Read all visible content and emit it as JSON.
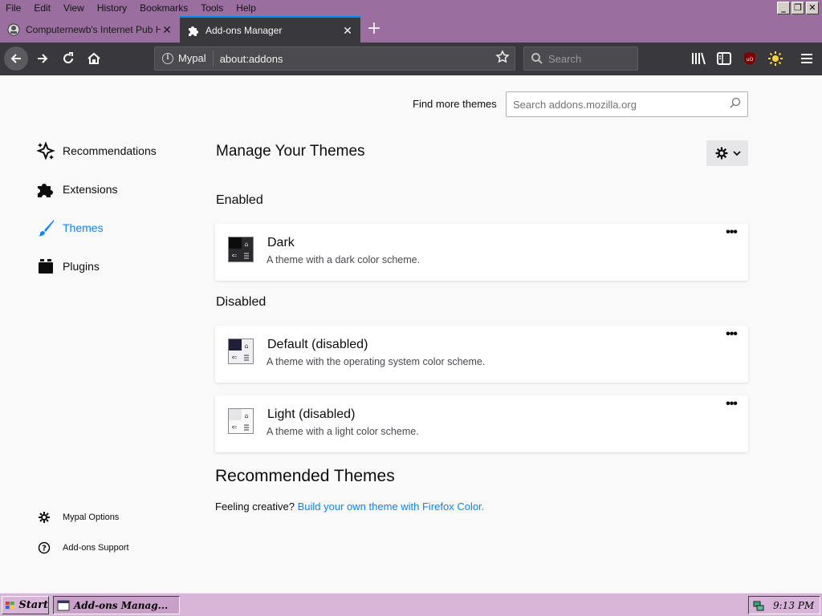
{
  "menu": [
    "File",
    "Edit",
    "View",
    "History",
    "Bookmarks",
    "Tools",
    "Help"
  ],
  "window_controls": {
    "minimize": "_",
    "restore": "❐",
    "close": "✕"
  },
  "tabs": [
    {
      "label": "Computernewb's Internet Pub Hub",
      "icon": "site-favicon",
      "active": false
    },
    {
      "label": "Add-ons Manager",
      "icon": "puzzle-icon",
      "active": true
    }
  ],
  "toolbar": {
    "identity_label": "Mypal",
    "url": "about:addons",
    "search_placeholder": "Search"
  },
  "addons": {
    "find_more_label": "Find more themes",
    "amo_search_placeholder": "Search addons.mozilla.org",
    "categories": [
      {
        "label": "Recommendations",
        "icon": "recommendations-icon"
      },
      {
        "label": "Extensions",
        "icon": "puzzle-icon"
      },
      {
        "label": "Themes",
        "icon": "brush-icon",
        "selected": true
      },
      {
        "label": "Plugins",
        "icon": "plugin-icon"
      }
    ],
    "footer_links": [
      {
        "label": "Mypal Options",
        "icon": "gear-icon"
      },
      {
        "label": "Add-ons Support",
        "icon": "help-icon"
      }
    ],
    "page_title": "Manage Your Themes",
    "enabled_heading": "Enabled",
    "disabled_heading": "Disabled",
    "enabled_themes": [
      {
        "name": "Dark",
        "description": "A theme with a dark color scheme.",
        "preview": "dark"
      }
    ],
    "disabled_themes": [
      {
        "name": "Default (disabled)",
        "description": "A theme with the operating system color scheme.",
        "preview": "default"
      },
      {
        "name": "Light (disabled)",
        "description": "A theme with a light color scheme.",
        "preview": "light"
      }
    ],
    "recommended_heading": "Recommended Themes",
    "creative_text": "Feeling creative?",
    "creative_link": "Build your own theme with Firefox Color.",
    "more_options": "•••"
  },
  "taskbar": {
    "start_label": "Start",
    "task_label": "Add-ons Manag...",
    "clock": "9:13 PM"
  },
  "colors": {
    "accent": "#0a84ff",
    "menubar": "#9b6ea0",
    "navbar": "#38383d",
    "taskbar": "#d8b4d8"
  }
}
